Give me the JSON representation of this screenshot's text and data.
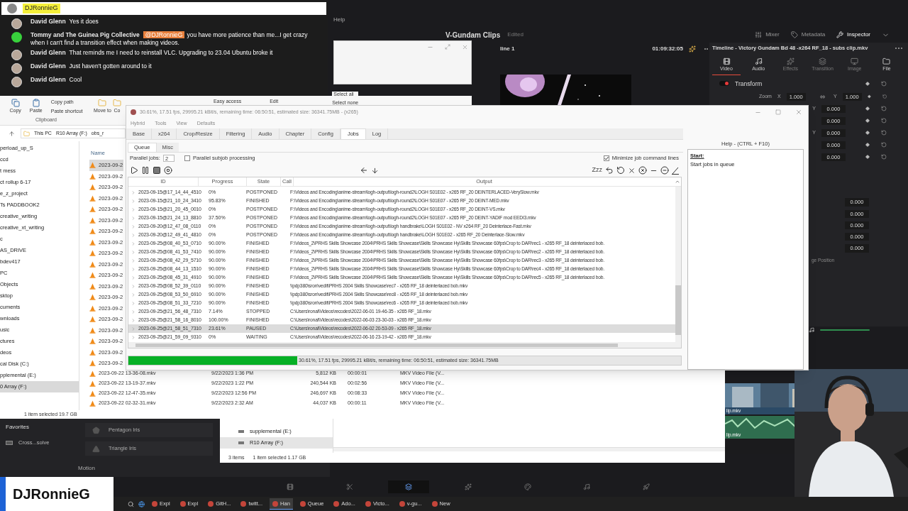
{
  "chat": {
    "header": "DJRonnieG",
    "messages": [
      {
        "author": "David Glenn",
        "text": "Yes it does"
      },
      {
        "author": "Tommy and The Guinea Pig Collective",
        "kind": "icon",
        "mention": "@DJRonnieG",
        "text": "you have more patience than me...I get crazy when I can't find a transition effect when making videos."
      },
      {
        "author": "David Glenn",
        "text": "That reminds me I need to reinstall VLC. Upgrading to 23.04 Ubuntu broke it"
      },
      {
        "author": "David Glenn",
        "text": "Just haven't gotten around to it"
      },
      {
        "author": "David Glenn",
        "text": "Cool"
      }
    ]
  },
  "davinci": {
    "menu": [
      "Help"
    ],
    "project": "V-Gundam Clips",
    "status": "Edited",
    "top_buttons": [
      {
        "label": "Mixer",
        "selected": false
      },
      {
        "label": "Metadata",
        "selected": false
      },
      {
        "label": "Inspector",
        "selected": true
      }
    ],
    "timeline_name": "line 1",
    "timecode": "01:09:32:05",
    "inspector_title": "Timeline - Victory Gundam Bd 48 -x264 RF_18 - subs clip.mkv",
    "inspector_tabs": [
      {
        "label": "Video",
        "selected": true,
        "disabled": false
      },
      {
        "label": "Audio",
        "selected": false,
        "disabled": false
      },
      {
        "label": "Effects",
        "selected": false,
        "disabled": true
      },
      {
        "label": "Transition",
        "selected": false,
        "disabled": true
      },
      {
        "label": "Image",
        "selected": false,
        "disabled": true
      },
      {
        "label": "File",
        "selected": false,
        "disabled": false
      }
    ],
    "section": {
      "label": "Transform",
      "on": true
    },
    "page_tabs": [
      {
        "selected": false
      },
      {
        "selected": false
      },
      {
        "selected": true
      },
      {
        "selected": false
      },
      {
        "selected": false
      },
      {
        "selected": false
      },
      {
        "selected": false
      }
    ],
    "zoom": {
      "label": "Zoom",
      "x_label": "X",
      "x_value": "1.000",
      "y_label": "Y",
      "y_value": "1.000"
    },
    "value_rows": [
      {
        "axis": "Y",
        "value": "0.000"
      },
      {
        "value": "0.000"
      },
      {
        "axis": "Y",
        "value": "0.000"
      },
      {
        "value": "0.000"
      },
      {
        "value": "0.000"
      }
    ],
    "lower_values": [
      "0.000",
      "0.000",
      "0.000",
      "0.000",
      "0.000"
    ],
    "position_label": "ge Position",
    "favorites": "Favorites",
    "favorite_items": [
      "Cross...solve"
    ],
    "transitions": [
      "Pentagon Iris",
      "Triangle Iris"
    ],
    "motion": "Motion",
    "clip_labels": [
      "lip.mkv",
      "lip.mkv"
    ]
  },
  "explorer": {
    "ribbon": {
      "copy": "Copy",
      "paste": "Paste",
      "copy_path": "Copy path",
      "paste_shortcut": "Paste shortcut",
      "clipboard": "Clipboard",
      "move_to": "Move to",
      "copy_to": "Co",
      "easy_access": "Easy access",
      "edit": "Edit",
      "select_all": "Select all",
      "select_none": "Select none"
    },
    "path": [
      "This PC",
      "R10 Array (F:)",
      "obs_r"
    ],
    "name_column": "Name",
    "nav": [
      {
        "label": "perload_up_S",
        "selected": false
      },
      {
        "label": "ccd",
        "selected": false
      },
      {
        "label": "t mess",
        "selected": false
      },
      {
        "label": "ct rollup 6-17",
        "selected": false
      },
      {
        "label": "e_z_project",
        "selected": false
      },
      {
        "label": "Ts PADDBOOK2",
        "selected": false
      },
      {
        "label": "creative_writing",
        "selected": false
      },
      {
        "label": "creative_xt_writing",
        "selected": false
      },
      {
        "label": "c",
        "selected": false
      },
      {
        "label": "AS_DRIVE",
        "selected": false
      },
      {
        "label": "bdev417",
        "selected": false
      },
      {
        "label": "PC",
        "selected": false
      },
      {
        "label": "Objects",
        "selected": false
      },
      {
        "label": "sktop",
        "selected": false
      },
      {
        "label": "cuments",
        "selected": false
      },
      {
        "label": "wnloads",
        "selected": false
      },
      {
        "label": "usic",
        "selected": false
      },
      {
        "label": "ctures",
        "selected": false
      },
      {
        "label": "deos",
        "selected": false
      },
      {
        "label": "cal Disk (C:)",
        "selected": false
      },
      {
        "label": "pplemental (E:)",
        "selected": false
      },
      {
        "label": "0 Array (F:)",
        "selected": true
      }
    ],
    "cut_files": [
      {
        "name": "2023-09-2",
        "selected": true
      },
      {
        "name": "2023-09-2",
        "selected": false
      },
      {
        "name": "2023-09-2",
        "selected": false
      },
      {
        "name": "2023-09-2",
        "selected": false
      },
      {
        "name": "2023-09-2",
        "selected": false
      },
      {
        "name": "2023-09-2",
        "selected": false
      },
      {
        "name": "2023-09-2",
        "selected": false
      },
      {
        "name": "2023-09-2",
        "selected": false
      },
      {
        "name": "2023-09-2",
        "selected": false
      },
      {
        "name": "2023-09-2",
        "selected": false
      },
      {
        "name": "2023-09-2",
        "selected": false
      },
      {
        "name": "2023-09-2",
        "selected": false
      },
      {
        "name": "2023-09-2",
        "selected": false
      },
      {
        "name": "2023-09-2",
        "selected": false
      },
      {
        "name": "2023-09-2",
        "selected": false
      },
      {
        "name": "2023-09-2",
        "selected": false
      },
      {
        "name": "2023-09-2",
        "selected": false
      },
      {
        "name": "2023-09-2",
        "selected": false
      },
      {
        "name": "2023-09-2",
        "selected": false
      }
    ],
    "files": [
      {
        "name": "2023-09-22 13-36-08.mkv",
        "date": "9/22/2023 1:36 PM",
        "size": "5,812 KB",
        "length": "00:00:01",
        "type": "MKV Video File (V..."
      },
      {
        "name": "2023-09-22 13-19-37.mkv",
        "date": "9/22/2023 1:22 PM",
        "size": "240,544 KB",
        "length": "00:02:56",
        "type": "MKV Video File (V..."
      },
      {
        "name": "2023-09-22 12-47-35.mkv",
        "date": "9/22/2023 12:56 PM",
        "size": "246,697 KB",
        "length": "00:08:33",
        "type": "MKV Video File (V..."
      },
      {
        "name": "2023-09-22 02-32-31.mkv",
        "date": "9/22/2023 2:32 AM",
        "size": "44,037 KB",
        "length": "00:00:11",
        "type": "MKV Video File (V..."
      }
    ],
    "status": "1 item selected 19.7 GB"
  },
  "explorer2": {
    "nav": [
      {
        "label": "supplemental (E:)",
        "selected": false
      },
      {
        "label": "R10 Array (F:)",
        "selected": true
      }
    ],
    "count": "3 items",
    "status": "1 item selected 1.17 GB"
  },
  "hybrid": {
    "title": "30.61%, 17.51 fps, 29995.21 kBit/s, remaining time: 06:50:51, estimated size: 36341.75MB - (x265)",
    "menu": [
      "Hybrid",
      "Tools",
      "View",
      "Defaults"
    ],
    "tabs": [
      {
        "label": "Base",
        "selected": false
      },
      {
        "label": "x264",
        "selected": false
      },
      {
        "label": "Crop/Resize",
        "selected": false
      },
      {
        "label": "Filtering",
        "selected": false
      },
      {
        "label": "Audio",
        "selected": false
      },
      {
        "label": "Chapter",
        "selected": false
      },
      {
        "label": "Config",
        "selected": false
      },
      {
        "label": "Jobs",
        "selected": true
      },
      {
        "label": "Log",
        "selected": false
      }
    ],
    "subtabs": [
      {
        "label": "Queue",
        "selected": true
      },
      {
        "label": "Misc",
        "selected": false
      }
    ],
    "parallel_label": "Parallel jobs:",
    "parallel_value": "2",
    "subjob": {
      "label": "Parallel subjob processing",
      "checked": false
    },
    "minimize": {
      "label": "Minimize job command lines",
      "checked": true
    },
    "sleep_label": "Zzz",
    "columns": [
      "ID",
      "Progress",
      "State",
      "Call",
      "Output"
    ],
    "rows": [
      {
        "id": "2023-09-15@17_14_44_4510",
        "progress": "0%",
        "state": "POSTPONED",
        "output": "F:\\Videos and Encoding\\anime-stream\\logh-output\\logh-round2\\LOGH S01E02 - x265 RF_20 DEINTERLACED-VerySlow.mkv",
        "selected": false
      },
      {
        "id": "2023-09-15@21_10_24_3410",
        "progress": "95.83%",
        "state": "FINISHED",
        "output": "F:\\Videos and Encoding\\anime-stream\\logh-output\\logh-round2\\LOGH S01E07 - x265 RF_20 DEINT-MED.mkv",
        "selected": false
      },
      {
        "id": "2023-09-15@21_20_45_0010",
        "progress": "0%",
        "state": "POSTPONED",
        "output": "F:\\Videos and Encoding\\anime-stream\\logh-output\\logh-round2\\LOGH S01E07 - x265 RF_20 DEINT-VS.mkv",
        "selected": false
      },
      {
        "id": "2023-09-15@21_24_13_8810",
        "progress": "37.50%",
        "state": "POSTPONED",
        "output": "F:\\Videos and Encoding\\anime-stream\\logh-output\\logh-round2\\LOGH S01E07 - x265 RF_20 DEINT-YADIF mod EEDI3.mkv",
        "selected": false
      },
      {
        "id": "2023-09-20@12_47_08_0110",
        "progress": "0%",
        "state": "POSTPONED",
        "output": "F:\\Videos and Encoding\\anime-stream\\logh-output\\logh handbrake\\LOGH S01E02 - NV x264 RF_20 Deinterlace-Fast.mkv",
        "selected": false
      },
      {
        "id": "2023-09-20@12_49_41_4810",
        "progress": "0%",
        "state": "POSTPONED",
        "output": "F:\\Videos and Encoding\\anime-stream\\logh-output\\logh handbrake\\LOGH S01E02 - x265 RF_20 Deinterlace-Slow.mkv",
        "selected": false
      },
      {
        "id": "2023-09-25@08_40_53_0710",
        "progress": "90.00%",
        "state": "FINISHED",
        "output": "F:\\Videos_2\\PRHS Skills Showcase 2004\\PRHS Skills Showcase\\Skills Showcase Hy\\Skills Showcase 60fps\\Crop to DAR\\rec1 - x265 RF_18 deinterlaced bob.",
        "selected": false
      },
      {
        "id": "2023-09-25@08_41_53_7410",
        "progress": "90.00%",
        "state": "FINISHED",
        "output": "F:\\Videos_2\\PRHS Skills Showcase 2004\\PRHS Skills Showcase\\Skills Showcase Hy\\Skills Showcase 60fps\\Crop to DAR\\rec2 - x265 RF_18 deinterlaced bob.",
        "selected": false
      },
      {
        "id": "2023-09-25@08_42_29_5710",
        "progress": "90.00%",
        "state": "FINISHED",
        "output": "F:\\Videos_2\\PRHS Skills Showcase 2004\\PRHS Skills Showcase\\Skills Showcase Hy\\Skills Showcase 60fps\\Crop to DAR\\rec3 - x265 RF_18 deinterlaced bob.",
        "selected": false
      },
      {
        "id": "2023-09-25@08_44_13_1510",
        "progress": "90.00%",
        "state": "FINISHED",
        "output": "F:\\Videos_2\\PRHS Skills Showcase 2004\\PRHS Skills Showcase\\Skills Showcase Hy\\Skills Showcase 60fps\\Crop to DAR\\rec4 - x265 RF_18 deinterlaced bob.",
        "selected": false
      },
      {
        "id": "2023-09-25@08_45_31_4910",
        "progress": "90.00%",
        "state": "FINISHED",
        "output": "F:\\Videos_2\\PRHS Skills Showcase 2004\\PRHS Skills Showcase\\Skills Showcase Hy\\Skills Showcase 60fps\\Crop to DAR\\rec5 - x265 RF_18 deinterlaced bob.",
        "selected": false
      },
      {
        "id": "2023-09-25@08_52_39_0110",
        "progress": "90.00%",
        "state": "FINISHED",
        "output": "\\\\pdp380\\sron\\vedit\\PRHS 2004 Skills Showcase\\rec7 - x265 RF_18 deinterlaced bob.mkv",
        "selected": false
      },
      {
        "id": "2023-09-25@08_53_50_6910",
        "progress": "90.00%",
        "state": "FINISHED",
        "output": "\\\\pdp380\\sron\\vedit\\PRHS 2004 Skills Showcase\\rec8 - x265 RF_18 deinterlaced bob.mkv",
        "selected": false
      },
      {
        "id": "2023-09-25@08_51_33_7210",
        "progress": "90.00%",
        "state": "FINISHED",
        "output": "\\\\pdp380\\sron\\vedit\\PRHS 2004 Skills Showcase\\rec6 - x265 RF_18 deinterlaced bob.mkv",
        "selected": false
      },
      {
        "id": "2023-09-25@21_56_48_7310",
        "progress": "7.14%",
        "state": "STOPPED",
        "output": "C:\\Users\\ronal\\Videos\\recodes\\2022-06-01 19-46-35 - x265 RF_18.mkv",
        "selected": false
      },
      {
        "id": "2023-09-25@21_58_16_8010",
        "progress": "100.00%",
        "state": "FINISHED",
        "output": "C:\\Users\\ronal\\Videos\\recodes\\2022-06-03 23-30-03 - x265 RF_18.mkv",
        "selected": false
      },
      {
        "id": "2023-09-25@21_58_51_7310",
        "progress": "23.61%",
        "state": "PAUSED",
        "output": "C:\\Users\\ronal\\Videos\\recodes\\2022-06-02 20-53-09 - x265 RF_18.mkv",
        "selected": true
      },
      {
        "id": "2023-09-25@21_59_09_9310",
        "progress": "0%",
        "state": "WAITING",
        "output": "C:\\Users\\ronal\\Videos\\recodes\\2022-06-16 23-19-42 - x265 RF_18.mkv",
        "selected": false
      }
    ],
    "progress": {
      "level": 0.3061,
      "text": "30.61%, 17.51 fps, 29995.21 kBit/s, remaining time: 06:50:51, estimated size: 36341.75MB"
    },
    "help_title": "Help - (CTRL + F10)",
    "help_heading": "Start:",
    "help_text": "Start jobs in queue"
  },
  "stream_badge": "DJRonnieG",
  "taskbar": [
    {
      "label": "Expl",
      "selected": false
    },
    {
      "label": "Expl",
      "selected": false
    },
    {
      "label": "GitH...",
      "selected": false
    },
    {
      "label": "twitt...",
      "selected": false
    },
    {
      "label": "Han",
      "selected": true
    },
    {
      "label": "Queue",
      "selected": false
    },
    {
      "label": "Ado...",
      "selected": false
    },
    {
      "label": "Victo...",
      "selected": false
    },
    {
      "label": "v-gu...",
      "selected": false
    },
    {
      "label": "New",
      "selected": false
    }
  ]
}
